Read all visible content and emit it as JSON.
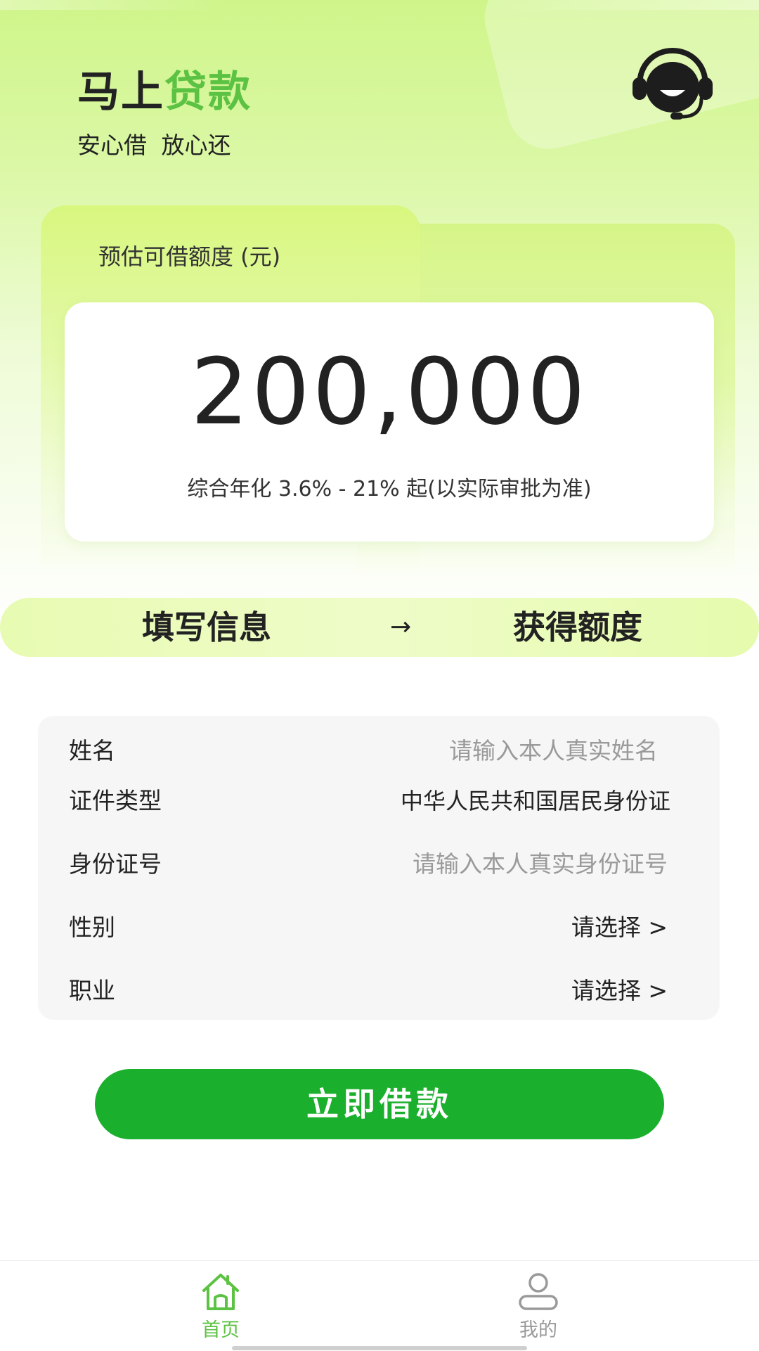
{
  "header": {
    "brand_main": "马上",
    "brand_accent": "贷款",
    "tagline": "安心借 放心还",
    "support_icon": "customer-service-headset-icon"
  },
  "quota_card": {
    "label": "预估可借额度 (元)",
    "amount": "200,000",
    "rate_text": "综合年化 3.6% - 21% 起(以实际审批为准)"
  },
  "steps": {
    "step1": "填写信息",
    "arrow": "→",
    "step2": "获得额度"
  },
  "form": {
    "name": {
      "label": "姓名",
      "placeholder": "请输入本人真实姓名"
    },
    "id_type": {
      "label": "证件类型",
      "value": "中华人民共和国居民身份证"
    },
    "id_number": {
      "label": "身份证号",
      "placeholder": "请输入本人真实身份证号"
    },
    "gender": {
      "label": "性别",
      "value": "请选择 >"
    },
    "occupation": {
      "label": "职业",
      "value": "请选择 >"
    }
  },
  "submit": {
    "label": "立即借款"
  },
  "tabbar": {
    "home": {
      "label": "首页",
      "icon": "home-icon"
    },
    "mine": {
      "label": "我的",
      "icon": "user-icon"
    }
  },
  "colors": {
    "brand_green": "#5cc243",
    "button_green": "#1aaf2c",
    "hero_lime": "#cff58a",
    "form_bg": "#f6f6f6",
    "placeholder_gray": "#9a9a9a"
  }
}
